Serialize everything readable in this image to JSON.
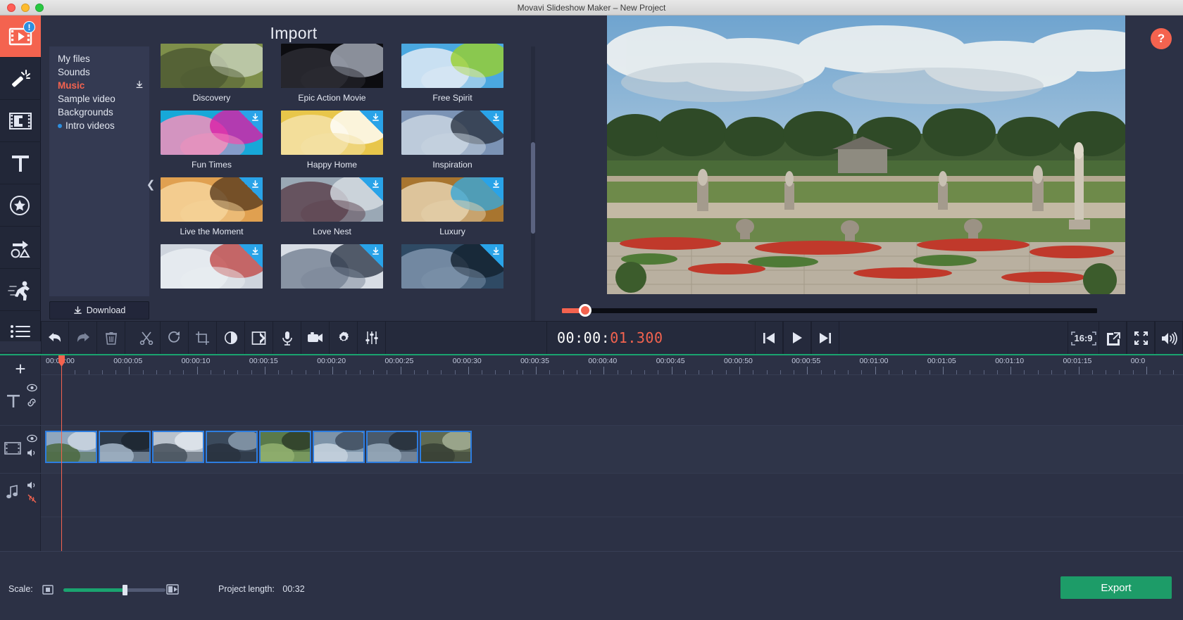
{
  "window": {
    "title": "Movavi Slideshow Maker – New Project",
    "traffic_lights": [
      "close",
      "minimize",
      "zoom"
    ]
  },
  "rail": {
    "items": [
      {
        "name": "import",
        "label": "Import",
        "icon": "film-play-icon",
        "active": true,
        "badge": "!"
      },
      {
        "name": "filters",
        "label": "Filters",
        "icon": "magic-wand-icon",
        "active": false,
        "badge": null
      },
      {
        "name": "transitions",
        "label": "Transitions",
        "icon": "film-transition-icon",
        "active": false,
        "badge": null
      },
      {
        "name": "titles",
        "label": "Titles",
        "icon": "text-t-icon",
        "active": false,
        "badge": null
      },
      {
        "name": "stickers",
        "label": "Stickers",
        "icon": "star-badge-icon",
        "active": false,
        "badge": null
      },
      {
        "name": "callouts",
        "label": "Callouts",
        "icon": "shapes-arrow-icon",
        "active": false,
        "badge": null
      },
      {
        "name": "animation",
        "label": "Animation",
        "icon": "running-person-icon",
        "active": false,
        "badge": null
      },
      {
        "name": "more",
        "label": "More tools",
        "icon": "list-lines-icon",
        "active": false,
        "badge": null
      }
    ]
  },
  "import": {
    "title": "Import",
    "categories": [
      {
        "label": "My files",
        "selected": false,
        "download": false,
        "bullet": false
      },
      {
        "label": "Sounds",
        "selected": false,
        "download": false,
        "bullet": false
      },
      {
        "label": "Music",
        "selected": true,
        "download": true,
        "bullet": false
      },
      {
        "label": "Sample video",
        "selected": false,
        "download": false,
        "bullet": false
      },
      {
        "label": "Backgrounds",
        "selected": false,
        "download": false,
        "bullet": false
      },
      {
        "label": "Intro videos",
        "selected": false,
        "download": false,
        "bullet": true
      }
    ],
    "download_button": "Download",
    "collapse_icon": "chevron-left-icon",
    "media": [
      {
        "label": "Discovery",
        "downloadable": false,
        "c1": "#7e8f4a",
        "c2": "#4d5a32",
        "c3": "#c9d3bc"
      },
      {
        "label": "Epic Action Movie",
        "downloadable": false,
        "c1": "#0c0c10",
        "c2": "#2b2b33",
        "c3": "#aab0bd"
      },
      {
        "label": "Free Spirit",
        "downloadable": false,
        "c1": "#4aa8e0",
        "c2": "#dfeaf4",
        "c3": "#9ad02a"
      },
      {
        "label": "Fun Times",
        "downloadable": true,
        "c1": "#17a8d8",
        "c2": "#f490bc",
        "c3": "#d91fa6"
      },
      {
        "label": "Happy Home",
        "downloadable": true,
        "c1": "#e8c64a",
        "c2": "#f4e2a8",
        "c3": "#ffffff"
      },
      {
        "label": "Inspiration",
        "downloadable": true,
        "c1": "#7b93b5",
        "c2": "#c9d5e2",
        "c3": "#2a3342"
      },
      {
        "label": "Live the Moment",
        "downloadable": true,
        "c1": "#e0a050",
        "c2": "#f6d39a",
        "c3": "#5a3c1e"
      },
      {
        "label": "Love Nest",
        "downloadable": true,
        "c1": "#9aa8b5",
        "c2": "#5d4450",
        "c3": "#d7dde4"
      },
      {
        "label": "Luxury",
        "downloadable": true,
        "c1": "#a8752f",
        "c2": "#e6d2ae",
        "c3": "#3aa7d8"
      },
      {
        "label": "",
        "downloadable": true,
        "c1": "#ced4dd",
        "c2": "#e9edf2",
        "c3": "#c24a4a"
      },
      {
        "label": "",
        "downloadable": true,
        "c1": "#d8dde5",
        "c2": "#7a8698",
        "c3": "#2f3a4a"
      },
      {
        "label": "",
        "downloadable": true,
        "c1": "#2f4a64",
        "c2": "#7e93ab",
        "c3": "#13202e"
      }
    ]
  },
  "preview": {
    "help_label": "?",
    "seek_position_pct": 3
  },
  "toolbar": {
    "buttons": [
      {
        "name": "undo",
        "label": "Undo",
        "icon": "undo-arrow-icon"
      },
      {
        "name": "redo",
        "label": "Redo",
        "icon": "redo-arrow-icon"
      },
      {
        "name": "delete",
        "label": "Delete",
        "icon": "trash-icon"
      },
      {
        "name": "split",
        "label": "Split",
        "icon": "scissors-icon"
      },
      {
        "name": "rotate",
        "label": "Rotate",
        "icon": "rotate-cw-icon"
      },
      {
        "name": "crop",
        "label": "Crop",
        "icon": "crop-icon"
      },
      {
        "name": "color-adjust",
        "label": "Color adjustments",
        "icon": "contrast-circle-icon"
      },
      {
        "name": "pan-zoom",
        "label": "Pan and zoom",
        "icon": "pan-zoom-icon"
      },
      {
        "name": "record-audio",
        "label": "Record audio",
        "icon": "microphone-icon"
      },
      {
        "name": "record-video",
        "label": "Record video",
        "icon": "video-camera-icon"
      },
      {
        "name": "clip-properties",
        "label": "Clip properties",
        "icon": "gear-icon"
      },
      {
        "name": "audio-mixer",
        "label": "Audio properties",
        "icon": "sliders-icon"
      }
    ]
  },
  "player": {
    "timecode_white": "00:00:",
    "timecode_red": "01.300",
    "controls": [
      {
        "name": "previous-frame",
        "label": "Previous",
        "icon": "skip-back-icon"
      },
      {
        "name": "play",
        "label": "Play",
        "icon": "play-icon"
      },
      {
        "name": "next-frame",
        "label": "Next",
        "icon": "skip-forward-icon"
      }
    ],
    "aspect_ratio": "16:9",
    "right_buttons": [
      {
        "name": "detach-player",
        "label": "Detach player",
        "icon": "external-window-icon"
      },
      {
        "name": "fullscreen",
        "label": "Fullscreen",
        "icon": "fullscreen-icon"
      },
      {
        "name": "volume",
        "label": "Volume",
        "icon": "speaker-icon"
      }
    ]
  },
  "timeline": {
    "add_button_icon": "plus-icon",
    "ruler_labels": [
      "00:00:00",
      "00:00:05",
      "00:00:10",
      "00:00:15",
      "00:00:20",
      "00:00:25",
      "00:00:30",
      "00:00:35",
      "00:00:40",
      "00:00:45",
      "00:00:50",
      "00:00:55",
      "00:01:00",
      "00:01:05",
      "00:01:10",
      "00:01:15",
      "00:0"
    ],
    "playhead_time": "00:00:01.300",
    "tracks": [
      {
        "name": "titles-track",
        "icons": [
          "text-t-icon",
          "eye-icon",
          "link-icon"
        ],
        "clips": []
      },
      {
        "name": "video-track",
        "icons": [
          "video-track-icon",
          "eye-icon",
          "speaker-icon"
        ],
        "clips": [
          {
            "c1": "#8fa6bd",
            "c2": "#4f6b45",
            "c3": "#cfd9e4"
          },
          {
            "c1": "#2e3a49",
            "c2": "#9fb0c2",
            "c3": "#1c2630"
          },
          {
            "c1": "#b9c2cc",
            "c2": "#4b5560",
            "c3": "#e3e9ef"
          },
          {
            "c1": "#3b4a5c",
            "c2": "#2a3340",
            "c3": "#8fa0b3"
          },
          {
            "c1": "#5a7a4a",
            "c2": "#8fae6e",
            "c3": "#2b3a26"
          },
          {
            "c1": "#7d93a8",
            "c2": "#c3d0dc",
            "c3": "#3c4a5a"
          },
          {
            "c1": "#4a5a6b",
            "c2": "#95a6b8",
            "c3": "#232c36"
          },
          {
            "c1": "#5f6a52",
            "c2": "#3a4236",
            "c3": "#a8b398"
          }
        ]
      },
      {
        "name": "audio-track",
        "icons": [
          "music-note-icon",
          "speaker-icon",
          "unlink-icon"
        ],
        "clips": []
      }
    ]
  },
  "bottom": {
    "scale_label": "Scale:",
    "scale_value_pct": 60,
    "scale_icon_left": "frame-small-icon",
    "scale_icon_right": "frame-large-icon",
    "project_length_label": "Project length:",
    "project_length_value": "00:32",
    "export_label": "Export"
  },
  "colors": {
    "accent_red": "#f4634f",
    "accent_blue": "#2d8fe0",
    "accent_green": "#1d9c68",
    "panel_bg": "#2c3145",
    "rail_bg": "#222738",
    "toolbar_bg": "#252a3c"
  }
}
